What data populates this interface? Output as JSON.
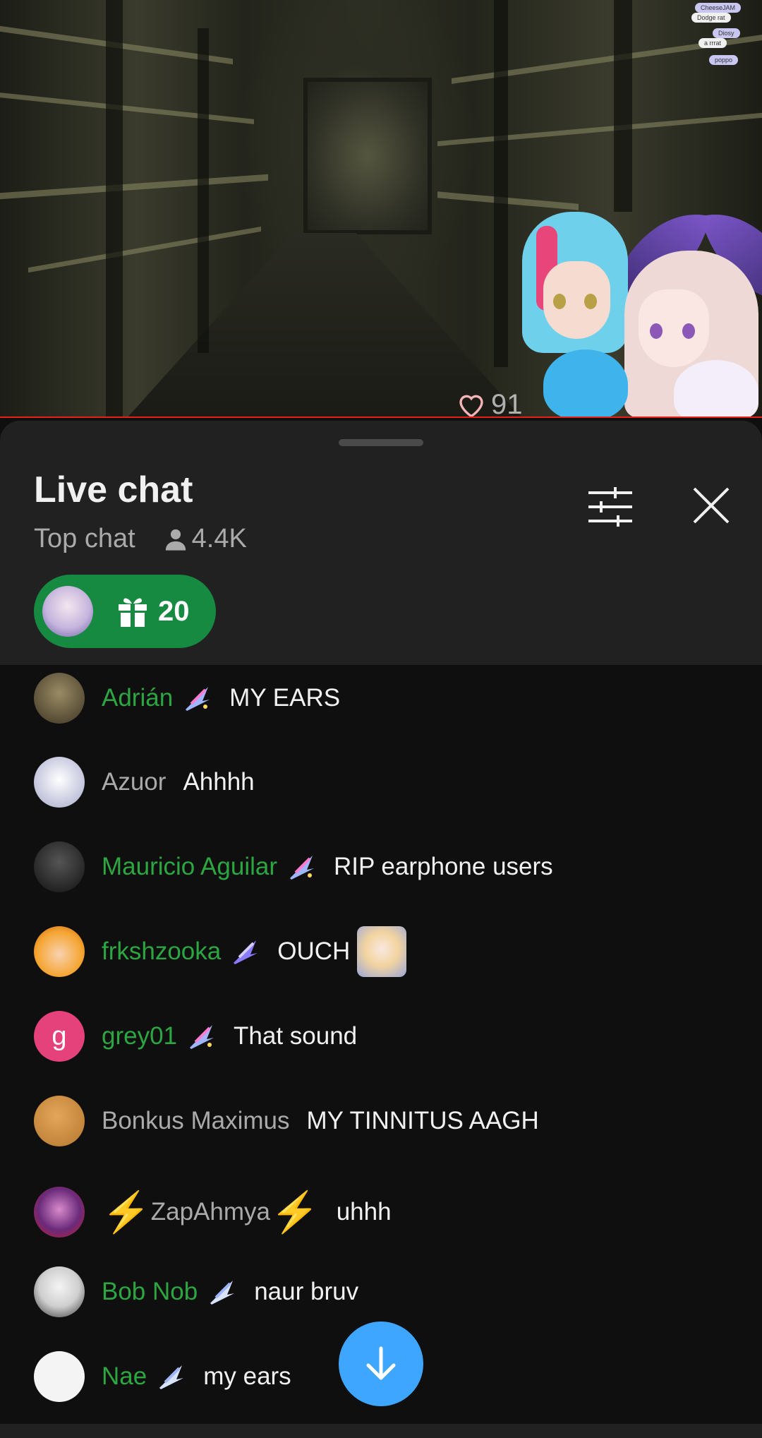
{
  "video": {
    "heart_count": "91",
    "overlay_bubbles": [
      "CheeseJAM",
      "Dodge rat",
      "Diosy",
      "a rrrat",
      "poppo"
    ]
  },
  "chat": {
    "title": "Live chat",
    "mode": "Top chat",
    "viewer_count": "4.4K",
    "gift_count": "20",
    "colors": {
      "member": "#2ba640",
      "regular": "#aaaaaa",
      "accent": "#3ea6ff",
      "gift_bg": "#168a40"
    },
    "messages": [
      {
        "author": "Adrián",
        "text": "MY EARS",
        "member": true,
        "avatar_color": "#6b6048",
        "badge": "member-badge-icon"
      },
      {
        "author": "Azuor",
        "text": "Ahhhh",
        "member": false,
        "avatar_color": "#c7c9dd",
        "badge": ""
      },
      {
        "author": "Mauricio Aguilar",
        "text": "RIP earphone users",
        "member": true,
        "avatar_color": "#2a2a2a",
        "badge": "member-badge-icon"
      },
      {
        "author": "frkshzooka",
        "text": "OUCH",
        "member": true,
        "avatar_color": "#f5a531",
        "badge": "member-badge-icon",
        "emote": "crying-emote"
      },
      {
        "author": "grey01",
        "text": "That sound",
        "member": true,
        "avatar_color": "#e5417a",
        "avatar_letter": "g",
        "badge": "member-badge-icon"
      },
      {
        "author": "Bonkus Maximus",
        "text": "MY TINNITUS AAGH",
        "member": false,
        "avatar_color": "#c98a3c",
        "badge": ""
      },
      {
        "author": "ZapAhmya",
        "text": "uhhh",
        "member": false,
        "avatar_color": "#6a2a7a",
        "badge": "",
        "bolt_decor": "⚡"
      },
      {
        "author": "Bob Nob",
        "text": "naur bruv",
        "member": true,
        "avatar_color": "#e9e9e9",
        "badge": "member-badge-icon"
      },
      {
        "author": "Nae",
        "text": "my ears",
        "member": true,
        "avatar_color": "#f4f4f4",
        "badge": "member-badge-icon"
      }
    ]
  }
}
